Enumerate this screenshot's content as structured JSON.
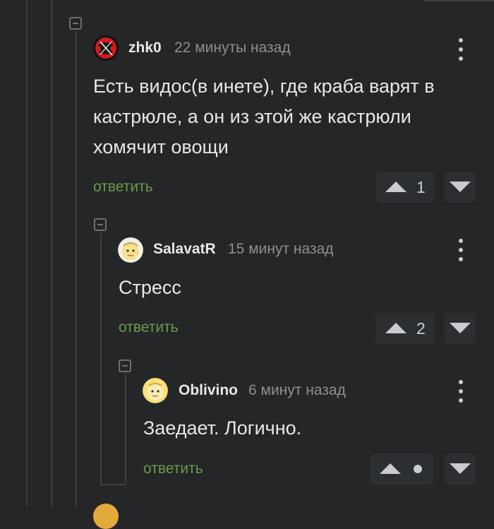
{
  "comments": [
    {
      "author": "zhk0",
      "time": "22 минуты назад",
      "text": "Есть видос(в инете), где краба варят в кастрюле, а он из этой же кастрюли хомячит овощи",
      "reply_label": "ответить",
      "rating": "1",
      "avatar_icon": "red-sticker-avatar"
    },
    {
      "author": "SalavatR",
      "time": "15 минут назад",
      "text": "Стресс",
      "reply_label": "ответить",
      "rating": "2",
      "avatar_icon": "cartoon-face-avatar"
    },
    {
      "author": "Oblivino",
      "time": "6 минут назад",
      "text": "Заедает. Логично.",
      "reply_label": "ответить",
      "rating": "",
      "avatar_icon": "cartoon-face-avatar"
    }
  ],
  "colors": {
    "background": "#242628",
    "reply_link": "#6a9b48",
    "meta_text": "#8b8f94",
    "body_text": "#e6e7e9",
    "thread_line": "#3b3e42"
  }
}
